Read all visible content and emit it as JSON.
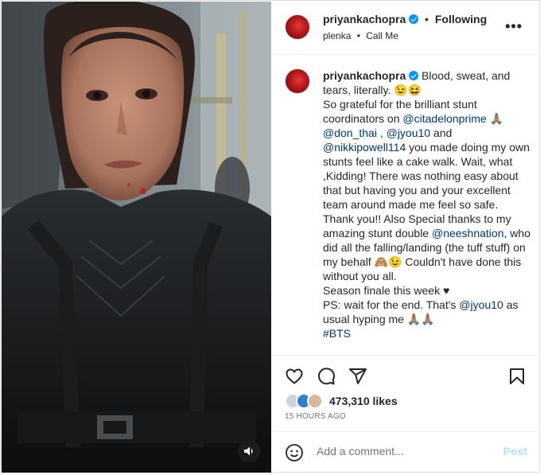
{
  "header": {
    "username": "priyankachopra",
    "separator": "•",
    "follow_status": "Following",
    "audio_artist": "plenka",
    "audio_track": "Call Me",
    "more_label": "•••"
  },
  "caption": {
    "username": "priyankachopra",
    "lines": [
      "Blood, sweat, and tears, literally. 😉😆",
      "So grateful for the brilliant stunt coordinators on",
      "@citadelonprime",
      "🙏🏽",
      "@don_thai",
      "@jyou10",
      "and",
      "@nikkipowell114",
      "you made doing my own stunts feel like a cake walk. Wait, what ,Kidding! There was nothing easy about that but having you and your excellent team around made me feel so safe. Thank you!! Also Special thanks to my amazing stunt double",
      "@neeshnation",
      ", who did all the falling/landing (the tuff stuff) on my behalf 🙈😉 Couldn't have done this without you all.",
      "Season finale this week ♥",
      "PS: wait for the end. That's",
      "usual hyping me 🙏🏽🙏🏽",
      "#BTS"
    ],
    "as_word": "as"
  },
  "actions": {
    "likes": "473,310 likes",
    "time": "15 HOURS AGO"
  },
  "comment": {
    "placeholder": "Add a comment...",
    "post_label": "Post"
  },
  "colors": {
    "link": "#00376b",
    "verified": "#0095f6",
    "post_disabled": "#b2dffc"
  },
  "icons": [
    "heart-icon",
    "comment-icon",
    "share-icon",
    "bookmark-icon",
    "emoji-icon",
    "audio-icon",
    "more-icon",
    "verified-icon"
  ]
}
